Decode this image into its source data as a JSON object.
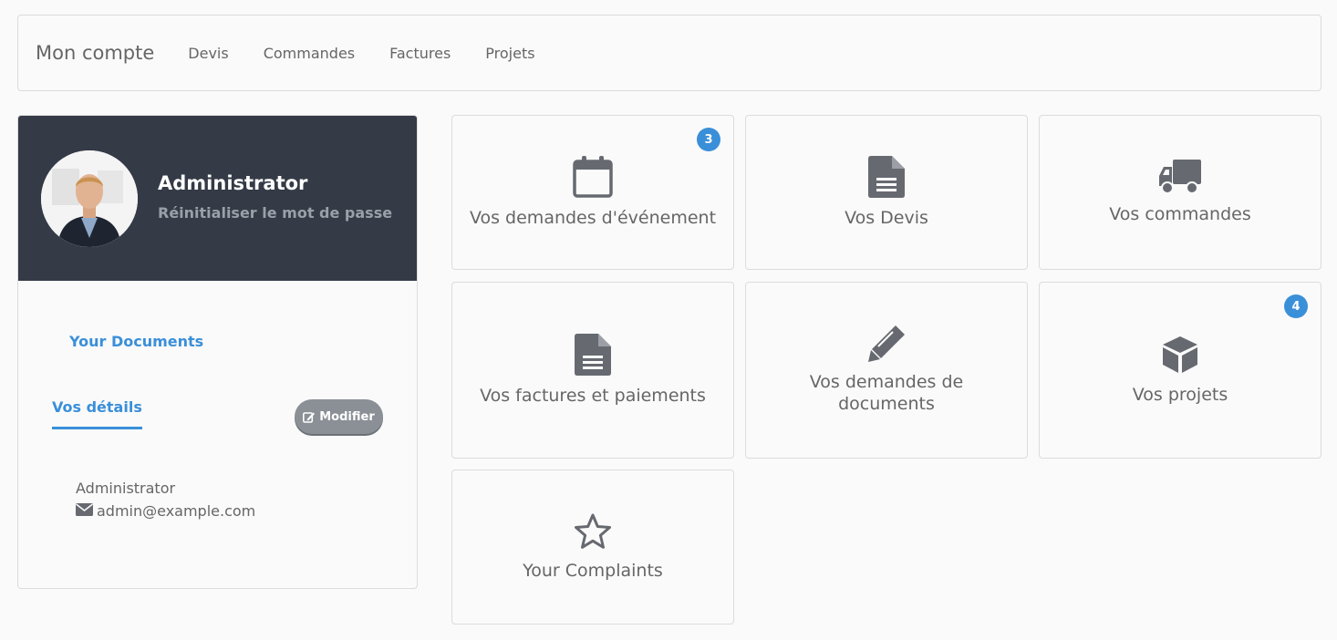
{
  "nav": {
    "brand": "Mon compte",
    "links": [
      "Devis",
      "Commandes",
      "Factures",
      "Projets"
    ]
  },
  "profile": {
    "name": "Administrator",
    "reset_password": "Réinitialiser le mot de passe",
    "documents_link": "Your Documents",
    "details_tab": "Vos détails",
    "edit_button": "Modifier",
    "detail_name": "Administrator",
    "detail_email": "admin@example.com"
  },
  "tiles": [
    {
      "label": "Vos demandes d'événement",
      "icon": "calendar-icon",
      "badge": "3"
    },
    {
      "label": "Vos Devis",
      "icon": "file-icon"
    },
    {
      "label": "Vos commandes",
      "icon": "truck-icon"
    },
    {
      "label": "Vos factures et paiements",
      "icon": "file-icon"
    },
    {
      "label": "Vos demandes de documents",
      "icon": "pencil-icon"
    },
    {
      "label": "Vos projets",
      "icon": "cube-icon",
      "badge": "4"
    },
    {
      "label": "Your Complaints",
      "icon": "star-icon"
    }
  ],
  "colors": {
    "accent": "#3a8fd9",
    "header_bg": "#343a46",
    "icon": "#666a70"
  }
}
